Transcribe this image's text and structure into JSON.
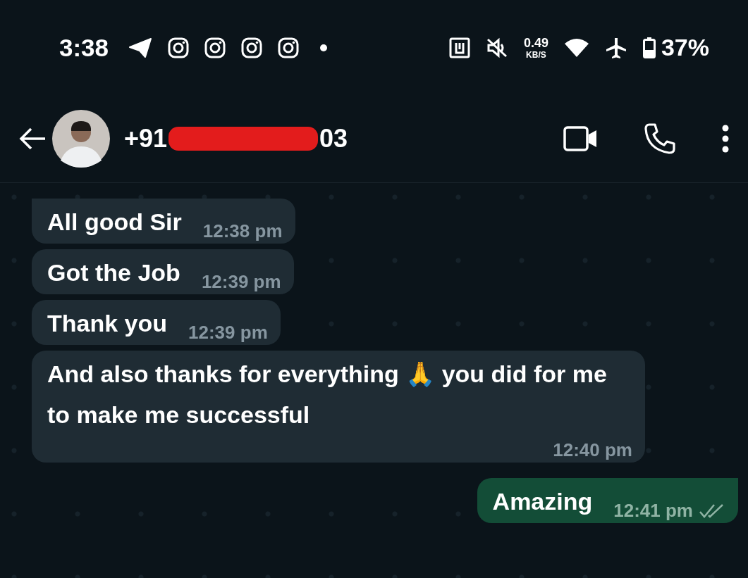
{
  "status_bar": {
    "time": "3:38",
    "speed_value": "0.49",
    "speed_unit": "KB/S",
    "battery": "37%"
  },
  "header": {
    "number_start": "+91",
    "number_end": "03",
    "redacted": true
  },
  "messages": [
    {
      "text": "All good Sir",
      "time": "12:38 pm",
      "outgoing": false,
      "tail": true
    },
    {
      "text": "Got the Job",
      "time": "12:39 pm",
      "outgoing": false,
      "tail": false
    },
    {
      "text": "Thank you",
      "time": "12:39 pm",
      "outgoing": false,
      "tail": false
    },
    {
      "text": "And also thanks for everything 🙏 you did for me to make me successful",
      "time": "12:40 pm",
      "outgoing": false,
      "tail": false
    },
    {
      "text": "Amazing",
      "time": "12:41 pm",
      "outgoing": true,
      "tail": true,
      "read": false
    }
  ]
}
